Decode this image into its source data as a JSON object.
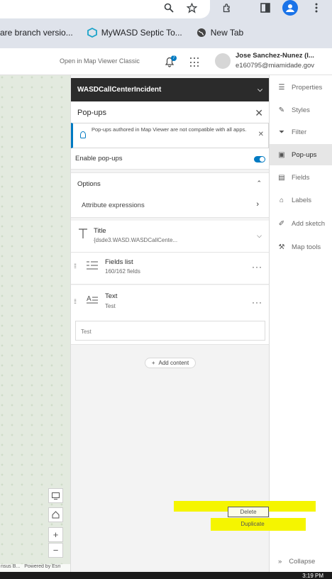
{
  "browser": {
    "bookmarks": [
      {
        "label": "are branch versio..."
      },
      {
        "label": "MyWASD Septic To..."
      },
      {
        "label": "New Tab"
      }
    ]
  },
  "header": {
    "open_map_viewer": "Open in Map Viewer Classic",
    "notifications_count": "7",
    "user_name": "Jose Sanchez-Nunez (I...",
    "user_email": "e160795@miamidade.gov"
  },
  "panel": {
    "layer_name": "WASDCallCenterIncident",
    "title": "Pop-ups",
    "notice": "Pop-ups authored in Map Viewer are not compatible with all apps.",
    "enable_label": "Enable pop-ups",
    "enable_on": true,
    "options_label": "Options",
    "attribute_expressions": "Attribute expressions",
    "cards": [
      {
        "title": "Title",
        "sub": "{dsde3.WASD.WASDCallCente..."
      },
      {
        "title": "Fields list",
        "sub": "160/162 fields"
      },
      {
        "title": "Text",
        "sub": "Test"
      }
    ],
    "text_preview": "Test",
    "add_content": "Add content"
  },
  "toolbar": {
    "items": [
      {
        "label": "Properties",
        "icon": "properties-icon"
      },
      {
        "label": "Styles",
        "icon": "styles-icon"
      },
      {
        "label": "Filter",
        "icon": "filter-icon"
      },
      {
        "label": "Pop-ups",
        "icon": "popups-icon",
        "active": true
      },
      {
        "label": "Fields",
        "icon": "fields-icon"
      },
      {
        "label": "Labels",
        "icon": "labels-icon"
      },
      {
        "label": "Add sketch",
        "icon": "sketch-icon"
      },
      {
        "label": "Map tools",
        "icon": "map-tools-icon"
      }
    ],
    "collapse": "Collapse"
  },
  "context_menu": {
    "delete": "Delete",
    "duplicate": "Duplicate",
    "highlight_color": "#f5f500"
  },
  "map": {
    "attribution_left": "nsus B...",
    "attribution_right": "Powered by Esri"
  },
  "taskbar": {
    "clock": "3:19 PM"
  }
}
